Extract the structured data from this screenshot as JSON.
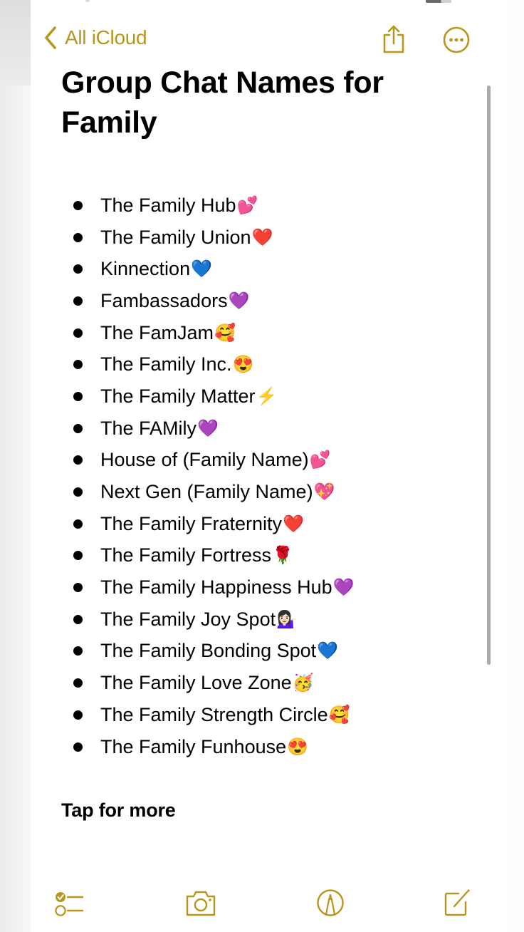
{
  "nav": {
    "back_label": "All iCloud",
    "back_icon": "chevron-left-icon",
    "share_icon": "share-icon",
    "more_icon": "ellipsis-circle-icon"
  },
  "note": {
    "title": "Group Chat Names for Family",
    "items": [
      {
        "text": "The Family Hub",
        "emoji": "💕"
      },
      {
        "text": "The Family Union",
        "emoji": "❤️"
      },
      {
        "text": "Kinnection",
        "emoji": "💙"
      },
      {
        "text": "Fambassadors",
        "emoji": "💜"
      },
      {
        "text": "The FamJam",
        "emoji": "🥰"
      },
      {
        "text": "The Family Inc.",
        "emoji": "😍"
      },
      {
        "text": "The Family Matter ",
        "emoji": "⚡"
      },
      {
        "text": "The FAMily",
        "emoji": "💜"
      },
      {
        "text": "House of (Family Name)",
        "emoji": "💕"
      },
      {
        "text": "Next Gen (Family Name)",
        "emoji": "💖"
      },
      {
        "text": "The Family Fraternity",
        "emoji": "❤️"
      },
      {
        "text": "The Family Fortress",
        "emoji": "🌹"
      },
      {
        "text": "The Family Happiness Hub",
        "emoji": "💜"
      },
      {
        "text": "The Family Joy Spot",
        "emoji": "💁🏻‍♀️"
      },
      {
        "text": "The Family Bonding Spot",
        "emoji": "💙"
      },
      {
        "text": "The Family Love Zone",
        "emoji": "🥳"
      },
      {
        "text": "The Family Strength Circle",
        "emoji": "🥰"
      },
      {
        "text": "The Family Funhouse",
        "emoji": "😍"
      }
    ],
    "footer_text": "Tap for more"
  },
  "toolbar": {
    "checklist_icon": "checklist-icon",
    "camera_icon": "camera-icon",
    "markup_icon": "markup-pen-icon",
    "compose_icon": "compose-icon"
  },
  "colors": {
    "accent": "#B8961E",
    "text": "#000000",
    "background": "#FFFFFF",
    "scrollbar": "#A9A9A9"
  }
}
